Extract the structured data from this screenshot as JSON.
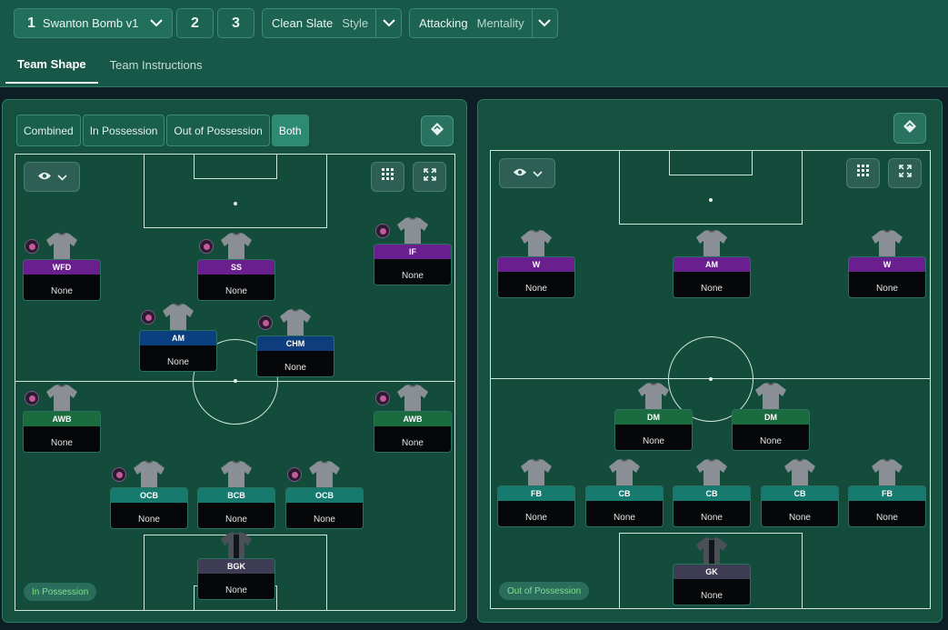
{
  "header": {
    "tactic_tabs": [
      {
        "number": "1",
        "name": "Swanton Bomb v1"
      },
      {
        "number": "2"
      },
      {
        "number": "3"
      }
    ],
    "style_value": "Clean Slate",
    "style_label": "Style",
    "mentality_value": "Attacking",
    "mentality_label": "Mentality"
  },
  "subtabs": [
    "Team Shape",
    "Team Instructions"
  ],
  "left_panel": {
    "toggles": [
      "Combined",
      "In Possession",
      "Out of Possession",
      "Both"
    ],
    "badge": "In Possession",
    "players": [
      {
        "role": "WFD",
        "name": "None"
      },
      {
        "role": "SS",
        "name": "None"
      },
      {
        "role": "IF",
        "name": "None"
      },
      {
        "role": "AM",
        "name": "None"
      },
      {
        "role": "CHM",
        "name": "None"
      },
      {
        "role": "AWB",
        "name": "None"
      },
      {
        "role": "AWB",
        "name": "None"
      },
      {
        "role": "OCB",
        "name": "None"
      },
      {
        "role": "BCB",
        "name": "None"
      },
      {
        "role": "OCB",
        "name": "None"
      },
      {
        "role": "BGK",
        "name": "None"
      }
    ]
  },
  "right_panel": {
    "badge": "Out of Possession",
    "players": [
      {
        "role": "W",
        "name": "None"
      },
      {
        "role": "AM",
        "name": "None"
      },
      {
        "role": "W",
        "name": "None"
      },
      {
        "role": "DM",
        "name": "None"
      },
      {
        "role": "DM",
        "name": "None"
      },
      {
        "role": "FB",
        "name": "None"
      },
      {
        "role": "CB",
        "name": "None"
      },
      {
        "role": "CB",
        "name": "None"
      },
      {
        "role": "CB",
        "name": "None"
      },
      {
        "role": "FB",
        "name": "None"
      },
      {
        "role": "GK",
        "name": "None"
      }
    ]
  },
  "icons": {
    "chevron": "chevron-down-icon",
    "eye": "eye-icon",
    "grid": "grid-icon",
    "expand": "expand-icon",
    "diamond": "tactics-diamond-icon",
    "shirt": "shirt-icon",
    "instruction": "instruction-bubble-icon"
  },
  "colors": {
    "attack_role": "#6a1f8e",
    "midfield_role": "#0c3f80",
    "defense_role": "#1a6b3e",
    "center_back_role": "#177a6f",
    "goalkeeper_role": "#3f3d55",
    "badge_text": "#7fe08a"
  }
}
